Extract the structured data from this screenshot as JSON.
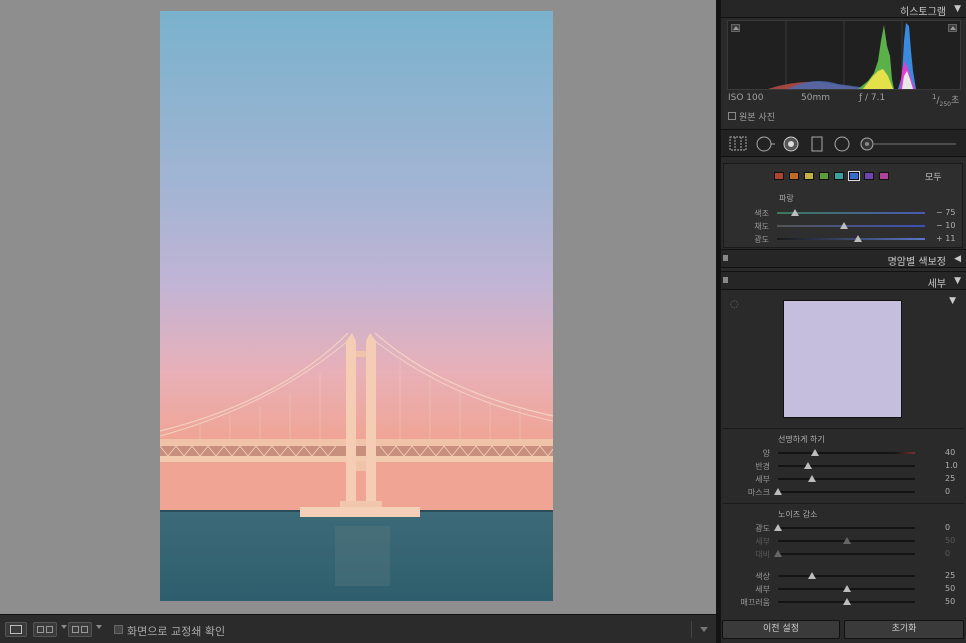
{
  "toolbar": {
    "softproof_label": "화면으로 교정쇄 확인"
  },
  "histogram": {
    "title": "히스토그램",
    "iso": "ISO 100",
    "focal": "50mm",
    "aperture": "ƒ / 7.1",
    "shutter_num": "1",
    "shutter_den": "250",
    "shutter_unit": "초",
    "original_photo_label": "원본 사진"
  },
  "hsl": {
    "all_label": "모두",
    "group_title": "파랑",
    "swatch_colors": [
      "#b04030",
      "#c06a2a",
      "#c8b040",
      "#5c9c3a",
      "#3aa0a0",
      "#3a6cd0",
      "#7044b0",
      "#b04098"
    ],
    "rows": [
      {
        "label": "색조",
        "value": "− 75",
        "level": 0.12,
        "track": "linear-gradient(90deg,#3a7a5a,#4a5ab0)"
      },
      {
        "label": "채도",
        "value": "− 10",
        "level": 0.45,
        "track": "linear-gradient(90deg,#555,#3b50b5)"
      },
      {
        "label": "광도",
        "value": "+ 11",
        "level": 0.55,
        "track": "linear-gradient(90deg,#1a1a1a,#5a78c8)"
      }
    ]
  },
  "split_toning": {
    "title": "명암별 색보정"
  },
  "detail": {
    "title": "세부",
    "sharpening": {
      "title": "선명하게 하기",
      "rows": [
        {
          "label": "양",
          "value": "40",
          "level": 0.27,
          "accent": true
        },
        {
          "label": "반경",
          "value": "1.0",
          "level": 0.22
        },
        {
          "label": "세부",
          "value": "25",
          "level": 0.25
        },
        {
          "label": "마스크",
          "value": "0",
          "level": 0.0
        }
      ]
    },
    "noise": {
      "title": "노이즈 감소",
      "rows": [
        {
          "label": "광도",
          "value": "0",
          "level": 0.0
        },
        {
          "label": "세부",
          "value": "50",
          "level": 0.5,
          "dim": true
        },
        {
          "label": "대비",
          "value": "0",
          "level": 0.0,
          "dim": true
        },
        {
          "label": "색상",
          "value": "25",
          "level": 0.25
        },
        {
          "label": "세부",
          "value": "50",
          "level": 0.5
        },
        {
          "label": "매끄러움",
          "value": "50",
          "level": 0.5
        }
      ]
    }
  },
  "footer": {
    "previous_label": "이전 설정",
    "reset_label": "초기화"
  }
}
